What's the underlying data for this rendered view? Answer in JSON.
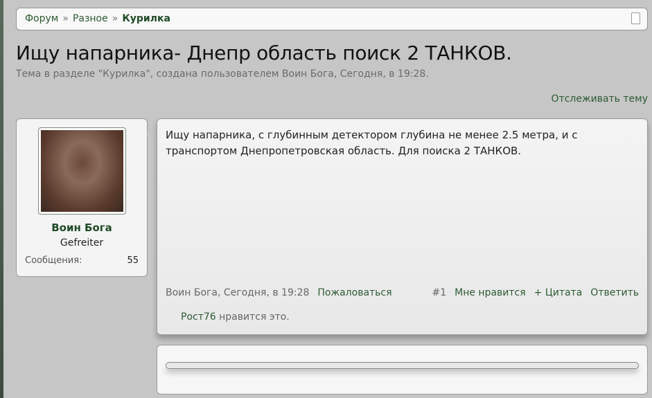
{
  "breadcrumb": {
    "items": [
      "Форум",
      "Разное"
    ],
    "current": "Курилка",
    "separator": "»"
  },
  "thread": {
    "title": "Ищу напарника- Днепр область поиск 2 ТАНКОВ.",
    "subtitle": "Тема в разделе \"Курилка\", создана пользователем Воин Бога, Сегодня, в 19:28.",
    "watch_label": "Отслеживать тему"
  },
  "user": {
    "name": "Воин Бога",
    "title": "Gefreiter",
    "messages_label": "Сообщения:",
    "messages_count": "55"
  },
  "post": {
    "text": "Ищу напарника, с глубинным детектором глубина не менее 2.5 метра, и с транспортом Днепропетровская область. Для поиска 2 ТАНКОВ.",
    "meta": "Воин Бога, Сегодня, в 19:28",
    "report": "Пожаловаться",
    "number": "#1",
    "like": "Мне нравится",
    "quote": "+ Цитата",
    "reply": "Ответить",
    "liker": "Рост76",
    "likes_suffix": " нравится это."
  }
}
